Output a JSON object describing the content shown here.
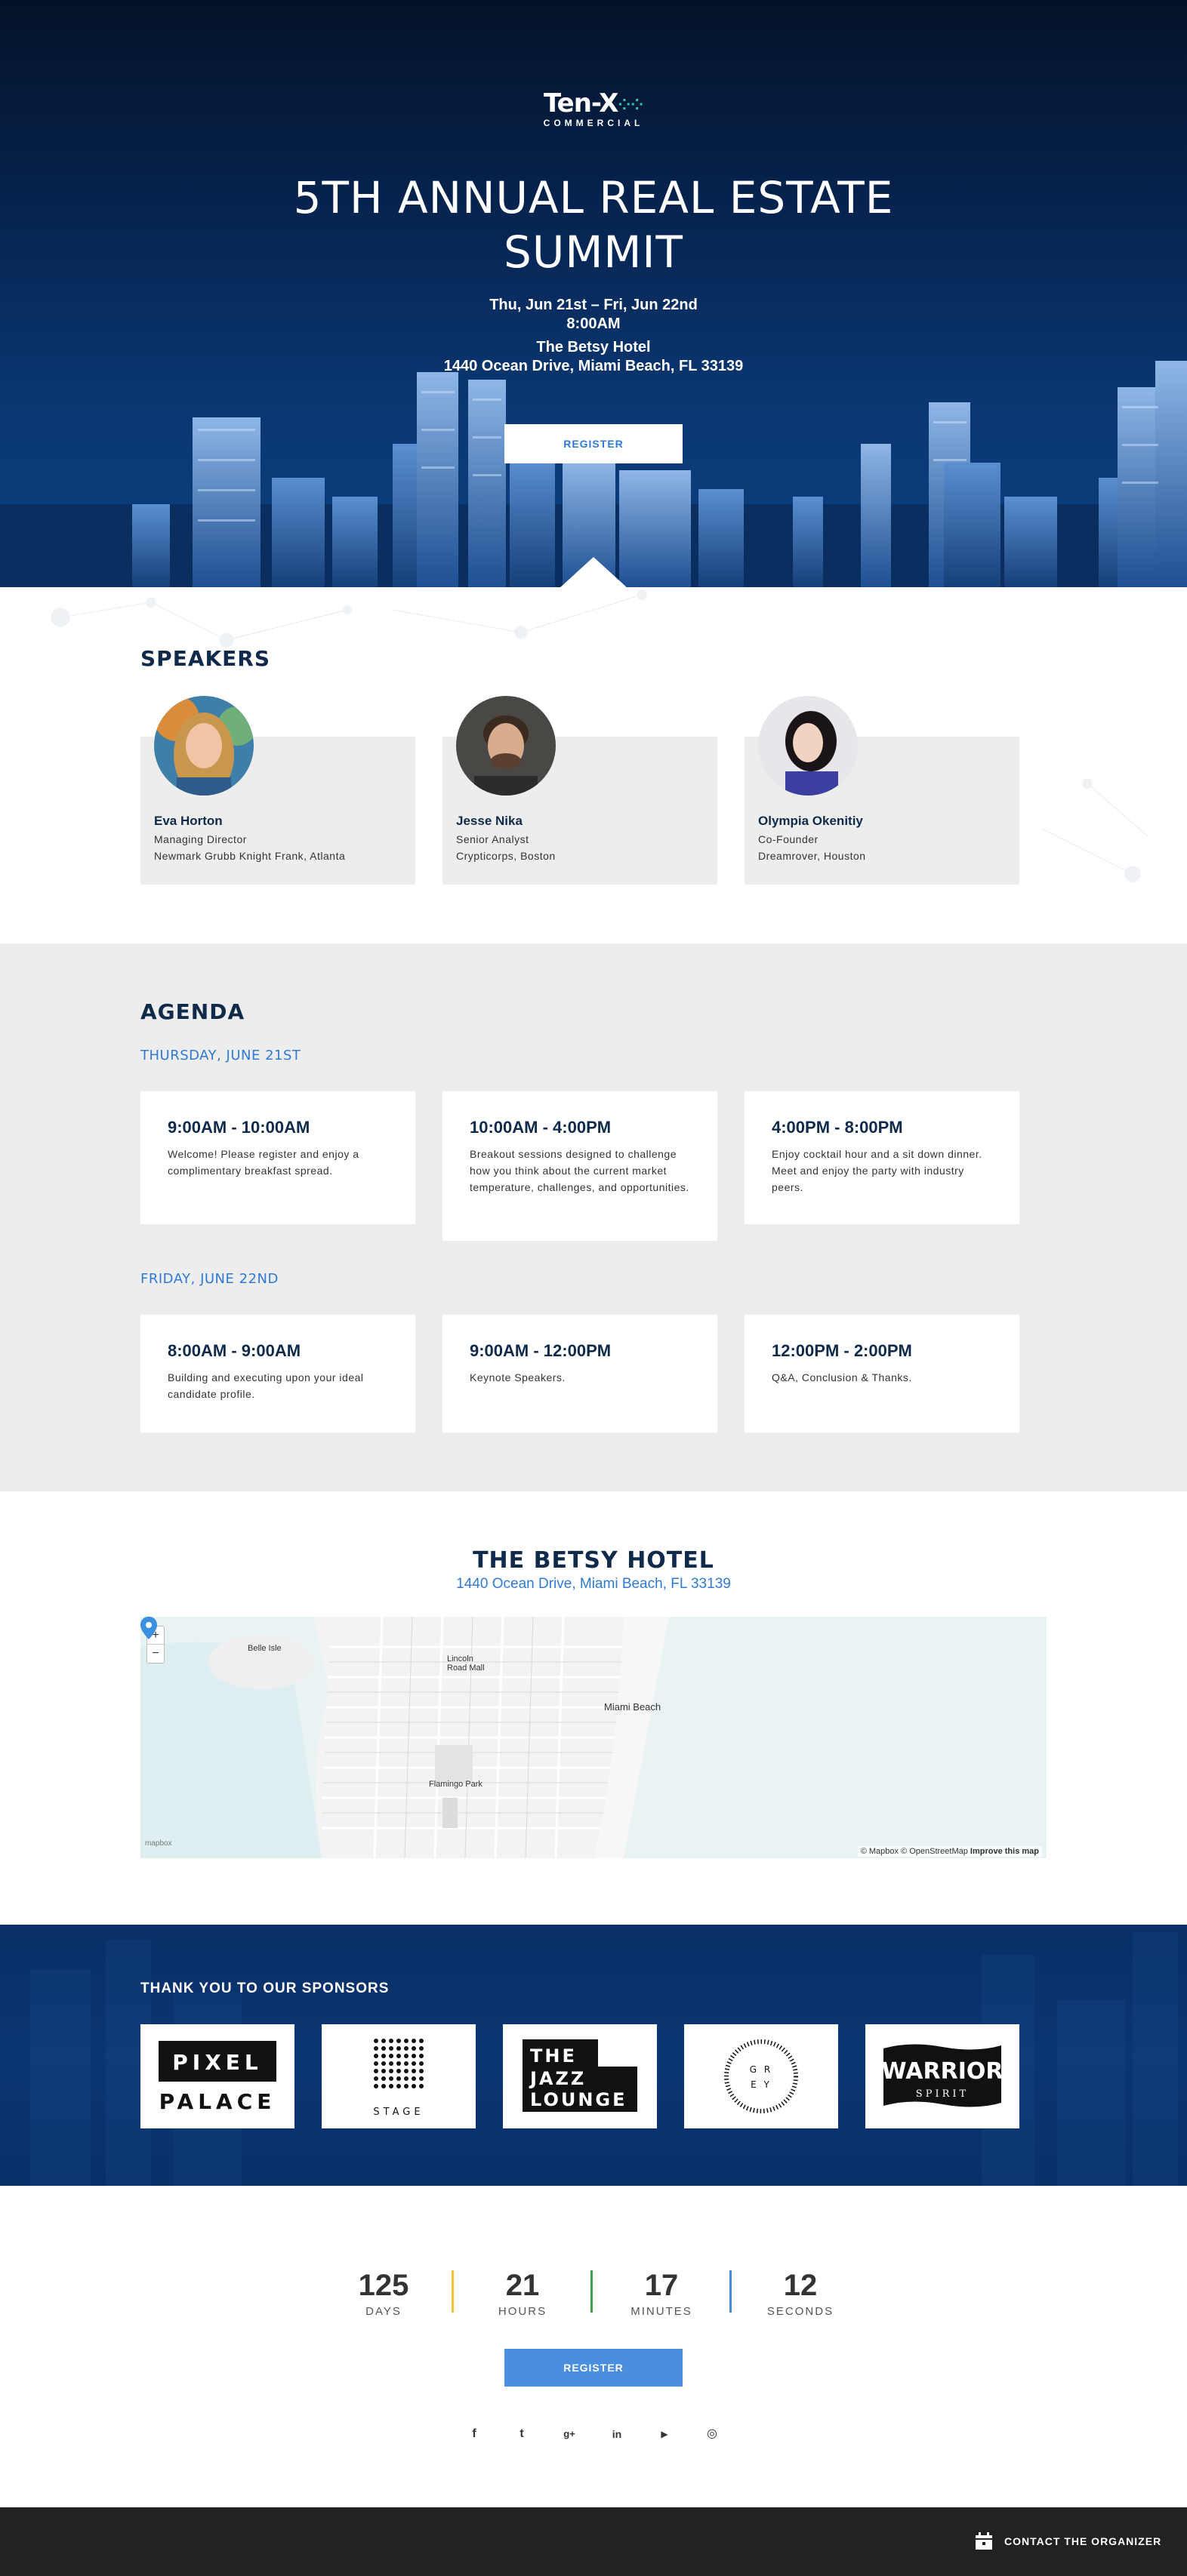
{
  "brand": {
    "name": "Ten-X",
    "sub": "COMMERCIAL"
  },
  "hero": {
    "title_line1": "5TH ANNUAL REAL ESTATE",
    "title_line2": "SUMMIT",
    "dates": "Thu, Jun 21st – Fri, Jun 22nd",
    "time": "8:00AM",
    "venue_name": "The Betsy Hotel",
    "venue_address": "1440 Ocean Drive, Miami Beach, FL 33139",
    "register_label": "REGISTER"
  },
  "speakers": {
    "title": "SPEAKERS",
    "items": [
      {
        "name": "Eva Horton",
        "role": "Managing Director",
        "org": "Newmark Grubb Knight Frank, Atlanta"
      },
      {
        "name": "Jesse Nika",
        "role": "Senior Analyst",
        "org": "Crypticorps, Boston"
      },
      {
        "name": "Olympia Okenitiy",
        "role": "Co-Founder",
        "org": "Dreamrover, Houston"
      }
    ]
  },
  "agenda": {
    "title": "AGENDA",
    "days": [
      {
        "label": "THURSDAY, JUNE 21ST",
        "sessions": [
          {
            "time": "9:00AM - 10:00AM",
            "desc": "Welcome! Please register and enjoy a complimentary breakfast spread."
          },
          {
            "time": "10:00AM - 4:00PM",
            "desc": "Breakout sessions designed to challenge how you think about the current market temperature, challenges, and opportunities."
          },
          {
            "time": "4:00PM - 8:00PM",
            "desc": "Enjoy cocktail hour and a sit down dinner. Meet and enjoy the party with industry peers."
          }
        ]
      },
      {
        "label": "FRIDAY, JUNE 22ND",
        "sessions": [
          {
            "time": "8:00AM - 9:00AM",
            "desc": "Building and executing upon your ideal candidate profile."
          },
          {
            "time": "9:00AM - 12:00PM",
            "desc": "Keynote Speakers."
          },
          {
            "time": "12:00PM - 2:00PM",
            "desc": "Q&A, Conclusion & Thanks."
          }
        ]
      }
    ]
  },
  "hotel": {
    "title": "THE BETSY HOTEL",
    "address": "1440 Ocean Drive, Miami Beach, FL 33139",
    "map": {
      "zoom_in": "+",
      "zoom_out": "−",
      "labels": {
        "belle_isle": "Belle Isle",
        "lincoln_road": "Lincoln Road Mall",
        "miami_beach": "Miami Beach",
        "flamingo_park": "Flamingo Park"
      },
      "attribution": "© Mapbox © OpenStreetMap",
      "improve": "Improve this map",
      "mapbox_logo": "mapbox"
    }
  },
  "sponsors": {
    "title": "THANK YOU TO OUR SPONSORS",
    "items": [
      {
        "name": "PIXEL PALACE",
        "line1": "PIXEL",
        "line2": "PALACE"
      },
      {
        "name": "STAGE",
        "line1": "STAGE"
      },
      {
        "name": "THE JAZZ LOUNGE",
        "line1": "THE",
        "line2": "JAZZ",
        "line3": "LOUNGE"
      },
      {
        "name": "GREY",
        "line1": "G R",
        "line2": "E Y"
      },
      {
        "name": "WARRIOR SPIRIT",
        "line1": "WARRIOR",
        "line2": "SPIRIT"
      }
    ]
  },
  "countdown": {
    "units": [
      {
        "value": "125",
        "label": "DAYS",
        "color": "#f2c230"
      },
      {
        "value": "21",
        "label": "HOURS",
        "color": "#3aa34a"
      },
      {
        "value": "17",
        "label": "MINUTES",
        "color": "#4a8ee0"
      },
      {
        "value": "12",
        "label": "SECONDS"
      }
    ],
    "register_label": "REGISTER"
  },
  "social": [
    {
      "icon": "facebook-icon",
      "glyph": "f"
    },
    {
      "icon": "twitter-icon",
      "glyph": "t"
    },
    {
      "icon": "google-plus-icon",
      "glyph": "g+"
    },
    {
      "icon": "linkedin-icon",
      "glyph": "in"
    },
    {
      "icon": "youtube-icon",
      "glyph": "▶"
    },
    {
      "icon": "instagram-icon",
      "glyph": "◎"
    }
  ],
  "footer": {
    "contact_label": "CONTACT THE ORGANIZER"
  },
  "colors": {
    "navy": "#0f2a4a",
    "accent": "#2f7ad7",
    "button_blue": "#4a8ee0",
    "footer": "#222222"
  }
}
